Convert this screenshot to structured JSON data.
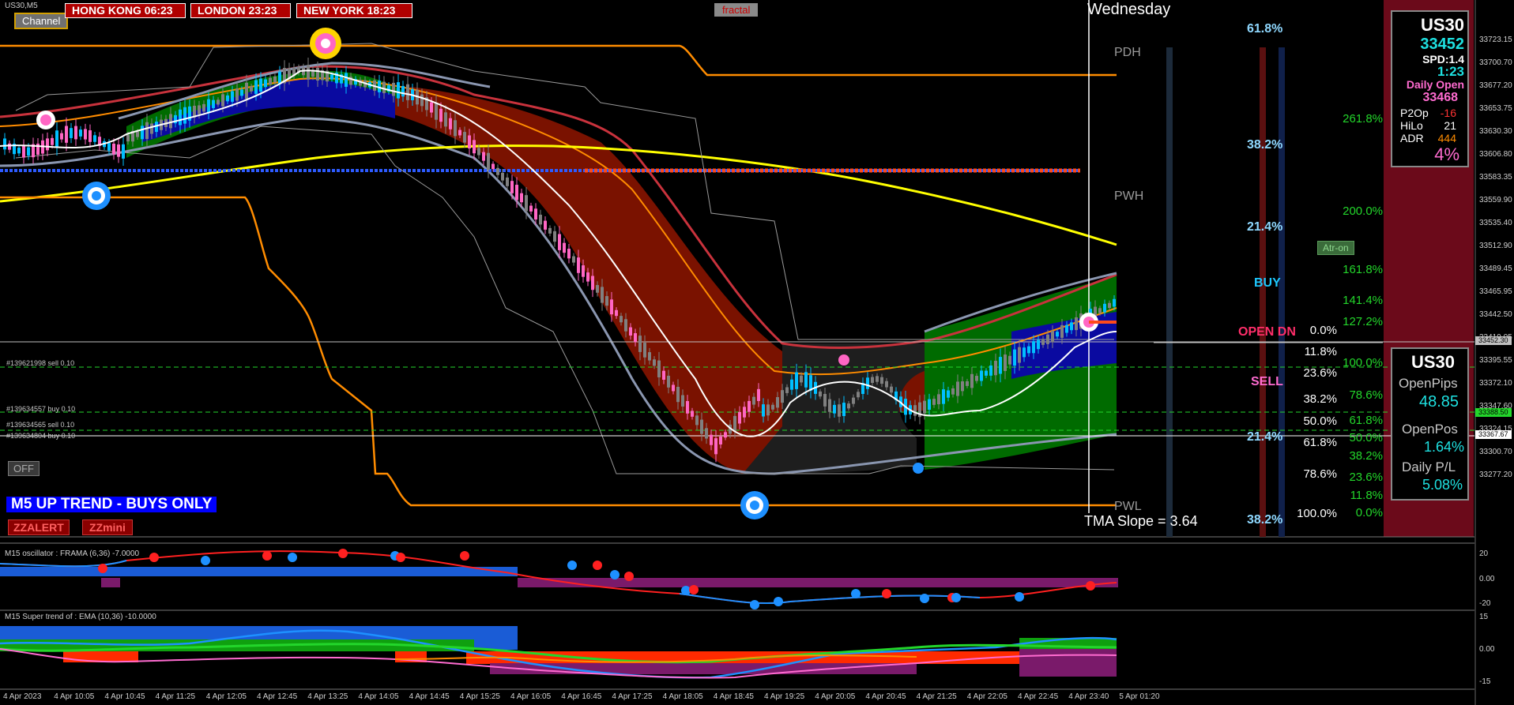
{
  "window": {
    "title": "US30,M5"
  },
  "buttons": {
    "channel": "Channel",
    "fractal": "fractal",
    "off": "OFF",
    "zzalert": "ZZALERT",
    "zzmini": "ZZmini",
    "atr": "Atr-on"
  },
  "sessions": [
    {
      "label": "HONG KONG 06:23"
    },
    {
      "label": "LONDON  23:23"
    },
    {
      "label": "NEW YORK 18:23"
    }
  ],
  "day_label": "Wednesday",
  "trend_banner": "M5 UP TREND - BUYS ONLY",
  "tma_slope": "TMA Slope = 3.64",
  "levels": {
    "pdh": "PDH",
    "pwh": "PWH",
    "pwl": "PWL"
  },
  "fib_mid": [
    {
      "label": "61.8%",
      "color": "#8fd8ff"
    },
    {
      "label": "38.2%",
      "color": "#8fd8ff"
    },
    {
      "label": "21.4%",
      "color": "#8fd8ff"
    },
    {
      "label": "BUY",
      "color": "#1ec8ff"
    },
    {
      "label": "OPEN  DN",
      "color": "#ff2e6a"
    },
    {
      "label": "SELL",
      "color": "#ff6bd0"
    },
    {
      "label": "21.4%",
      "color": "#8fd8ff"
    },
    {
      "label": "38.2%",
      "color": "#8fd8ff"
    }
  ],
  "fib_white": [
    "0.0%",
    "11.8%",
    "23.6%",
    "38.2%",
    "50.0%",
    "61.8%",
    "78.6%",
    "100.0%"
  ],
  "fib_green": [
    "261.8%",
    "200.0%",
    "161.8%",
    "141.4%",
    "127.2%",
    "100.0%",
    "78.6%",
    "61.8%",
    "50.0%",
    "38.2%",
    "23.6%",
    "11.8%",
    "0.0%"
  ],
  "info_panel": {
    "symbol": "US30",
    "price": "33452",
    "spread": "SPD:1.4",
    "time": "1:23",
    "daily_open_label": "Daily Open",
    "daily_open": "33468",
    "rows": [
      {
        "k": "P2Op",
        "v": "-16",
        "color": "#ff3333"
      },
      {
        "k": "HiLo",
        "v": "21",
        "color": "#ffffff"
      },
      {
        "k": "ADR",
        "v": "444",
        "color": "#ff8c00"
      }
    ],
    "percent": "4%"
  },
  "pips_panel": {
    "symbol": "US30",
    "open_pips_label": "OpenPips",
    "open_pips": "48.85",
    "open_pos_label": "OpenPos",
    "open_pos": "1.64%",
    "daily_pl_label": "Daily P/L",
    "daily_pl": "5.08%"
  },
  "orders": [
    "#139621998 sell 0.10",
    "#139634557 buy 0.10",
    "#139634565 sell 0.10",
    "#139634804 buy 0.10"
  ],
  "price_axis": [
    "33723.15",
    "33700.70",
    "33677.20",
    "33653.75",
    "33630.30",
    "33606.80",
    "33583.35",
    "33559.90",
    "33535.40",
    "33512.90",
    "33489.45",
    "33465.95",
    "33442.50",
    "33419.05",
    "33395.55",
    "33372.10",
    "33347.60",
    "33324.15",
    "33300.70",
    "33277.20"
  ],
  "price_tags": [
    {
      "label": "33452.30",
      "color": "#c0c0c0",
      "text": "#000000"
    },
    {
      "label": "33388.50",
      "color": "#23d62b",
      "text": "#000000"
    },
    {
      "label": "33367.67",
      "color": "#ffffff",
      "text": "#000000"
    }
  ],
  "osc1": {
    "title": "M15  oscillator : FRAMA (6,36)  -7.0000",
    "ticks": [
      "20",
      "0.00",
      "-20"
    ]
  },
  "osc2": {
    "title": "M15  Super trend of : EMA (10,36)  -10.0000",
    "ticks": [
      "15",
      "0.00",
      "-15"
    ]
  },
  "time_axis": [
    "4 Apr 2023",
    "4 Apr 10:05",
    "4 Apr 10:45",
    "4 Apr 11:25",
    "4 Apr 12:05",
    "4 Apr 12:45",
    "4 Apr 13:25",
    "4 Apr 14:05",
    "4 Apr 14:45",
    "4 Apr 15:25",
    "4 Apr 16:05",
    "4 Apr 16:45",
    "4 Apr 17:25",
    "4 Apr 18:05",
    "4 Apr 18:45",
    "4 Apr 19:25",
    "4 Apr 20:05",
    "4 Apr 20:45",
    "4 Apr 21:25",
    "4 Apr 22:05",
    "4 Apr 22:45",
    "4 Apr 23:40",
    "5 Apr 01:20"
  ],
  "colors": {
    "bull_band": "#006b00",
    "bear_band": "#7a1200",
    "neutral_band": "#1e1e1e",
    "yellow_ma": "#ffff00",
    "orange": "#ff8c00"
  }
}
